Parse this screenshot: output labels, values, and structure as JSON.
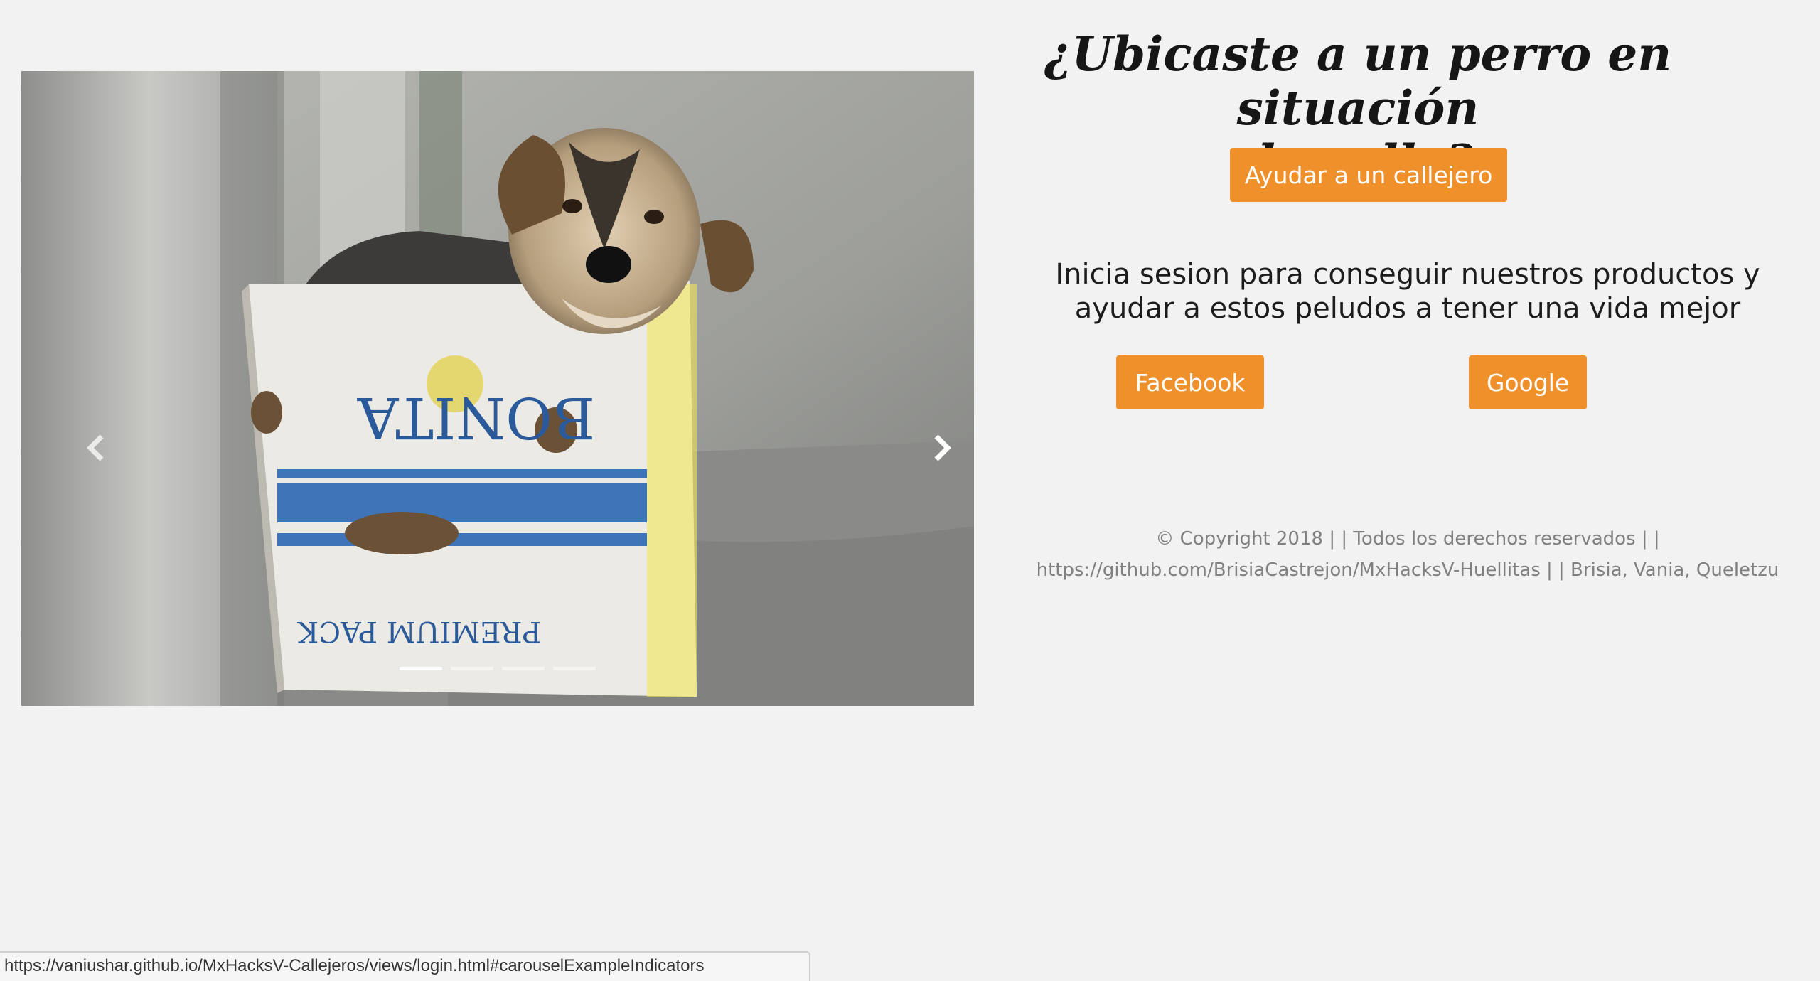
{
  "carousel": {
    "image_label": "BONITA",
    "image_label_2": "PREMIUM PACK",
    "prev_icon": "chevron-left-icon",
    "next_icon": "chevron-right-icon",
    "slide_count": 4,
    "active_slide": 1
  },
  "hero": {
    "headline_line1": "¿Ubicaste a un perro en situación",
    "headline_line2": "de calle?",
    "help_button": "Ayudar a un callejero"
  },
  "login": {
    "text_line1": "Inicia sesion para conseguir nuestros productos y",
    "text_line2": "ayudar a estos peludos a tener una vida mejor",
    "facebook_button": "Facebook",
    "google_button": "Google"
  },
  "footer": {
    "line1": "© Copyright 2018 | | Todos los derechos reservados | |",
    "line2": "https://github.com/BrisiaCastrejon/MxHacksV-Huellitas | | Brisia, Vania, Queletzu"
  },
  "status_bar": {
    "url": "https://vaniushar.github.io/MxHacksV-Callejeros/views/login.html#carouselExampleIndicators"
  },
  "colors": {
    "background": "#f2f2f2",
    "accent": "#f0902a",
    "headline": "#161616",
    "footer_text": "#808080"
  }
}
